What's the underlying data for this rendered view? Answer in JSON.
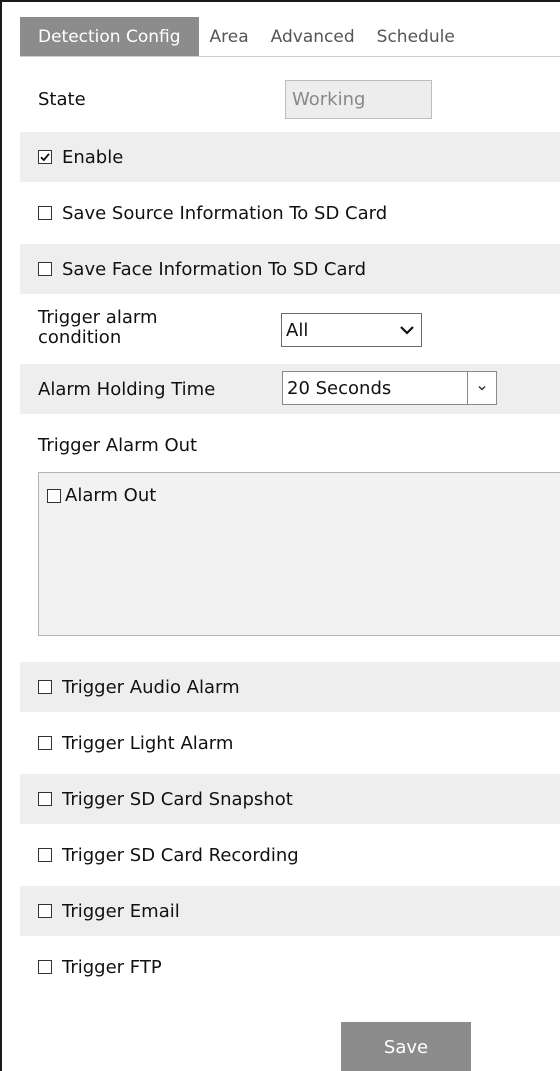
{
  "tabs": [
    {
      "label": "Detection Config",
      "active": true
    },
    {
      "label": "Area",
      "active": false
    },
    {
      "label": "Advanced",
      "active": false
    },
    {
      "label": "Schedule",
      "active": false
    }
  ],
  "state": {
    "label": "State",
    "value": "Working"
  },
  "enable": {
    "label": "Enable",
    "checked": true
  },
  "save_source": {
    "label": "Save Source Information To SD Card",
    "checked": false
  },
  "save_face": {
    "label": "Save Face Information To SD Card",
    "checked": false
  },
  "trigger_condition": {
    "label_line1": "Trigger alarm",
    "label_line2": "condition",
    "value": "All"
  },
  "holding_time": {
    "label": "Alarm Holding Time",
    "value": "20 Seconds"
  },
  "trigger_alarm_out": {
    "label": "Trigger Alarm Out",
    "options": [
      {
        "label": "Alarm Out",
        "checked": false
      }
    ]
  },
  "triggers": [
    {
      "label": "Trigger Audio Alarm",
      "checked": false
    },
    {
      "label": "Trigger Light Alarm",
      "checked": false
    },
    {
      "label": "Trigger SD Card Snapshot",
      "checked": false
    },
    {
      "label": "Trigger SD Card Recording",
      "checked": false
    },
    {
      "label": "Trigger Email",
      "checked": false
    },
    {
      "label": "Trigger FTP",
      "checked": false
    }
  ],
  "save_button": "Save",
  "colors": {
    "tab_active": "#8c8c8c",
    "row_alt": "#eeeeee",
    "button": "#8c8c8c"
  }
}
